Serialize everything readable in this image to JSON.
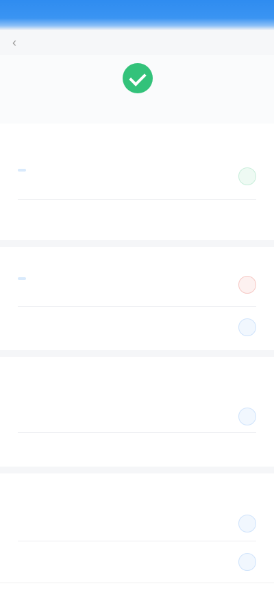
{
  "header": {
    "title": "",
    "back_icon": "chevron-left-icon",
    "status_text": ""
  },
  "section1": {
    "title": "",
    "tag": "",
    "action_label": "",
    "row_label": "",
    "row_value": ""
  },
  "section2": {
    "title": "",
    "tag": "",
    "action_label": "",
    "row_label": "",
    "row_action": ""
  },
  "section3": {
    "title": "",
    "status": "",
    "row1_label": "",
    "row1_action": "",
    "row2_label": "",
    "row2_value": ""
  },
  "section4": {
    "title": "",
    "row1_label": "",
    "row1_action": "",
    "row2_label": "",
    "row2_action": ""
  },
  "bottom": {
    "left_label": "",
    "mid_label": ""
  },
  "colors": {
    "primary": "#2f8cf0",
    "success": "#33c27a",
    "danger": "#e54d42"
  }
}
